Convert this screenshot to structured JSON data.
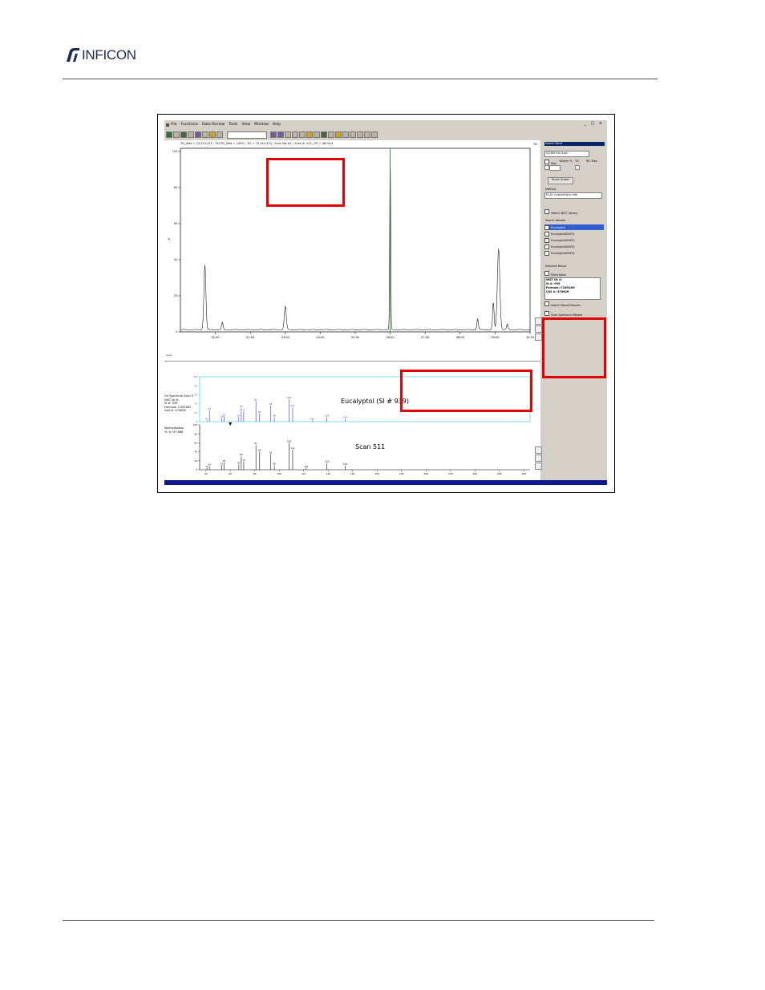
{
  "logo": {
    "text": "INFICON"
  },
  "app": {
    "menu": [
      "File",
      "Functions",
      "Data Review",
      "Tools",
      "View",
      "Window",
      "Help"
    ],
    "window_controls": "_ □ ×",
    "chart_header": "TIC_Max = 72,413,472 ; TIC/TIC_Max = 100% ; TIC = 72,413,472 ; Scan Set #1 ; Scan #: 511 ; RT = 06:04.4",
    "chart_right_label": "TIC"
  },
  "right_panel": {
    "title": "Search Panel",
    "mode": "GC/MS Full Scan",
    "options": [
      "Max",
      "%Norm %",
      "TIC",
      "RIC Max"
    ],
    "pause_button": "Pause Screen",
    "method_label": "Method",
    "method_value": "EI Air CustomConc.mth",
    "search_nist": "Search NIST Library",
    "search_results_label": "Search Results",
    "results": [
      "Eucalyptol",
      "Eucalyptol(DUP1)",
      "Eucalyptol(DUP2)",
      "Eucalyptol(DUP3)",
      "Eucalyptol(DUP4)"
    ],
    "selected_result_label": "Selected Result",
    "description_label": "Description",
    "description_lines": [
      "NIST lib #: ",
      "SI #: 939",
      "Formula: C10H18O",
      "CAS #: 470826"
    ],
    "search_result_masses": "Search Result Masses",
    "scan_spectrum_masses": "Scan Spectrum Masses"
  },
  "spectrum": {
    "lib_info": [
      "On Spectrum Scan 5",
      "NIST lib #:",
      "SI #: 939",
      "Formula: C10H18O",
      "CAS #: 470826"
    ],
    "normalization": [
      "Normalization",
      "TI: 6,747,666"
    ],
    "library_label": "Eucalyptol (SI # 939)",
    "scan_label": "Scan 511"
  },
  "chart_data": [
    {
      "type": "line",
      "title": "",
      "x": [
        "01:00",
        "02:00",
        "03:00",
        "04:00",
        "05:00",
        "06:00",
        "07:00",
        "08:00",
        "09:00",
        "10:00"
      ],
      "ylabel": "%",
      "ylim": [
        0,
        100
      ],
      "yticks": [
        0,
        20,
        40,
        60,
        80,
        100
      ],
      "peaks_min": [
        [
          0.7,
          36
        ],
        [
          1.2,
          4
        ],
        [
          3.0,
          13
        ],
        [
          6.0,
          100
        ],
        [
          8.5,
          6
        ],
        [
          8.95,
          15
        ],
        [
          9.1,
          45
        ],
        [
          9.35,
          3
        ]
      ]
    },
    {
      "type": "bar",
      "title": "Eucalyptol (SI # 939)",
      "x_axis_ticks": [
        40,
        60,
        80,
        100,
        120,
        140,
        160,
        180,
        200,
        220,
        240,
        260,
        280,
        300
      ],
      "library_peaks": [
        [
          41,
          3
        ],
        [
          43,
          25
        ],
        [
          53,
          8
        ],
        [
          55,
          12
        ],
        [
          67,
          10
        ],
        [
          69,
          30
        ],
        [
          71,
          22
        ],
        [
          81,
          45
        ],
        [
          84,
          18
        ],
        [
          93,
          36
        ],
        [
          96,
          10
        ],
        [
          108,
          50
        ],
        [
          111,
          32
        ],
        [
          127,
          2
        ],
        [
          139,
          10
        ],
        [
          154,
          6
        ]
      ],
      "scan_peaks": [
        [
          41,
          4
        ],
        [
          43,
          8
        ],
        [
          53,
          10
        ],
        [
          55,
          16
        ],
        [
          67,
          12
        ],
        [
          69,
          30
        ],
        [
          71,
          18
        ],
        [
          81,
          55
        ],
        [
          84,
          40
        ],
        [
          93,
          35
        ],
        [
          96,
          10
        ],
        [
          108,
          60
        ],
        [
          111,
          45
        ],
        [
          122,
          4
        ],
        [
          139,
          15
        ],
        [
          154,
          9
        ]
      ]
    }
  ]
}
